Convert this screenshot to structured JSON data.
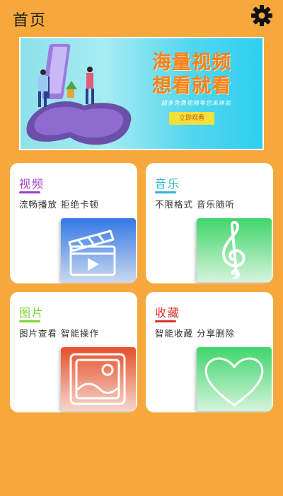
{
  "header": {
    "title": "首页",
    "settings_icon": "gear-icon"
  },
  "banner": {
    "headline_line1": "海量视频",
    "headline_line2": "想看就看",
    "subline": "超多免费视频等您来体验",
    "button_label": "立即观看"
  },
  "cards": [
    {
      "title": "视频",
      "desc": "流畅播放 拒绝卡顿",
      "icon": "clapperboard-icon",
      "accent": "#A33DC8",
      "tile_top": "#3478E6",
      "tile_bottom": "#C9D8EE"
    },
    {
      "title": "音乐",
      "desc": "不限格式 音乐随听",
      "icon": "treble-clef-icon",
      "accent": "#2BB5D6",
      "tile_top": "#3FD66B",
      "tile_bottom": "#D6F3DC"
    },
    {
      "title": "图片",
      "desc": "图片查看 智能操作",
      "icon": "image-icon",
      "accent": "#7FD43A",
      "tile_top": "#E5502A",
      "tile_bottom": "#F6D6CC"
    },
    {
      "title": "收藏",
      "desc": "智能收藏 分享删除",
      "icon": "heart-icon",
      "accent": "#D9342B",
      "tile_top": "#3FD66B",
      "tile_bottom": "#D6F3DC"
    }
  ]
}
